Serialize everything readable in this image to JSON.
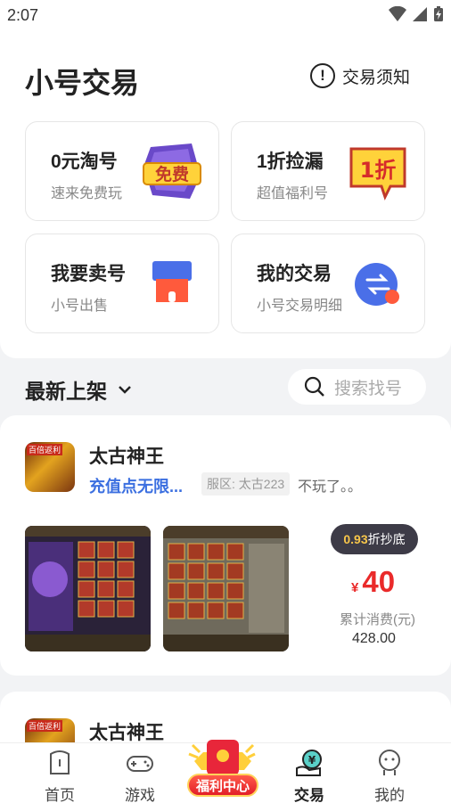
{
  "status": {
    "time": "2:07"
  },
  "header": {
    "title": "小号交易",
    "notice_label": "交易须知",
    "notice_icon": "info-icon"
  },
  "cards": [
    {
      "title": "0元淘号",
      "subtitle": "速来免费玩",
      "icon_text": "免费"
    },
    {
      "title": "1折捡漏",
      "subtitle": "超值福利号",
      "icon_text": "1折"
    },
    {
      "title": "我要卖号",
      "subtitle": "小号出售"
    },
    {
      "title": "我的交易",
      "subtitle": "小号交易明细"
    }
  ],
  "section": {
    "title": "最新上架",
    "search_placeholder": "搜索找号"
  },
  "listings": [
    {
      "game_name": "太古神王",
      "icon_badge": "百倍返利",
      "title": "充值点无限...",
      "server_tag": "服区: 太古223",
      "description": "不玩了。。",
      "discount_value": "0.93",
      "discount_suffix": "折抄底",
      "price_symbol": "¥",
      "price": "40",
      "cumulative_label": "累计消费(元)",
      "cumulative_value": "428.00"
    },
    {
      "game_name": "太古神王",
      "icon_badge": "百倍返利"
    }
  ],
  "tabbar": {
    "tabs": [
      {
        "label": "首页"
      },
      {
        "label": "游戏"
      },
      {
        "label": "福利中心"
      },
      {
        "label": "交易"
      },
      {
        "label": "我的"
      }
    ],
    "active": "交易"
  },
  "colors": {
    "accent_red": "#ea2a2a",
    "link_blue": "#3b6fe0",
    "badge_dark": "#3d3b47"
  }
}
